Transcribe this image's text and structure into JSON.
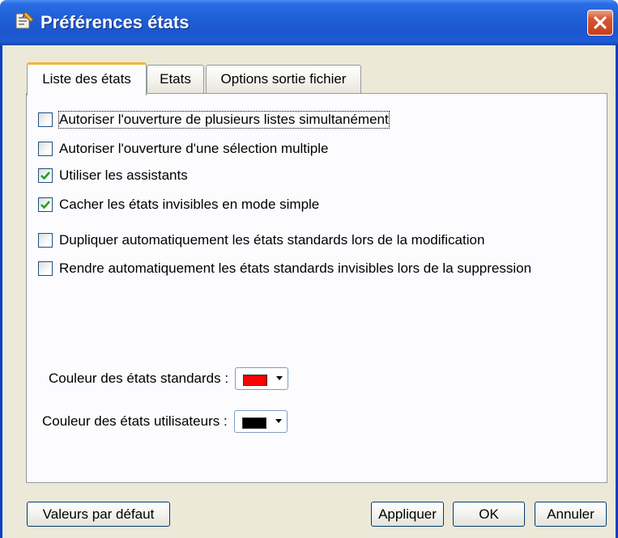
{
  "window": {
    "title": "Préférences états"
  },
  "tabs": [
    {
      "label": "Liste des états",
      "active": true
    },
    {
      "label": "Etats",
      "active": false
    },
    {
      "label": "Options sortie fichier",
      "active": false
    }
  ],
  "options": [
    {
      "label": "Autoriser l'ouverture de plusieurs listes simultanément",
      "checked": false
    },
    {
      "label": "Autoriser l'ouverture d'une sélection multiple",
      "checked": false
    },
    {
      "label": "Utiliser les assistants",
      "checked": true
    },
    {
      "label": "Cacher les états invisibles en mode simple",
      "checked": true
    },
    {
      "label": "Dupliquer automatiquement les états standards lors de la modification",
      "checked": false
    },
    {
      "label": "Rendre automatiquement les états standards invisibles lors de la suppression",
      "checked": false
    }
  ],
  "colors": {
    "standard": {
      "label": "Couleur des états standards :",
      "value": "#ff0000"
    },
    "user": {
      "label": "Couleur des états utilisateurs :",
      "value": "#000000"
    }
  },
  "buttons": {
    "defaults": "Valeurs par défaut",
    "apply": "Appliquer",
    "ok": "OK",
    "cancel": "Annuler"
  },
  "theme": {
    "titlebar": "#1f5fd6",
    "check_color": "#21a121",
    "close": "#d8542e"
  }
}
